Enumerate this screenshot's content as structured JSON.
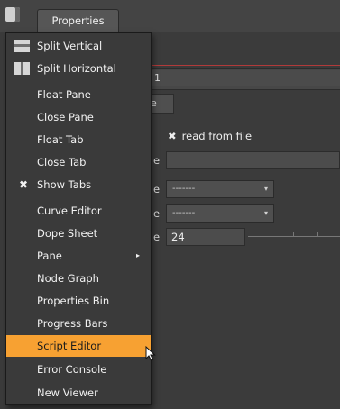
{
  "header": {
    "tab_label": "Properties"
  },
  "panel": {
    "name_field_value": "1",
    "sub_tab_label": "e",
    "read_from_file_label": "read from file",
    "read_from_file_mark": "✖",
    "param_label_1": "e",
    "param_label_2": "e",
    "param_label_3": "e",
    "param_label_4": "e",
    "dropdown_1_value": "-------",
    "dropdown_2_value": "-------",
    "fps_value": "24"
  },
  "menu": {
    "items": [
      {
        "label": "Split Vertical",
        "icon": "split-vertical-icon"
      },
      {
        "label": "Split Horizontal",
        "icon": "split-horizontal-icon"
      },
      {
        "label": "Float Pane"
      },
      {
        "label": "Close Pane"
      },
      {
        "label": "Float Tab"
      },
      {
        "label": "Close Tab"
      },
      {
        "label": "Show Tabs",
        "checked_mark": "✖"
      },
      {
        "label": "Curve Editor"
      },
      {
        "label": "Dope Sheet"
      },
      {
        "label": "Pane",
        "submenu_mark": "▸"
      },
      {
        "label": "Node Graph"
      },
      {
        "label": "Properties Bin"
      },
      {
        "label": "Progress Bars"
      },
      {
        "label": "Script Editor",
        "highlighted": true
      },
      {
        "label": "Error Console"
      },
      {
        "label": "New Viewer"
      }
    ]
  },
  "colors": {
    "highlight": "#f7a132",
    "accent_line": "#b23a3a"
  }
}
